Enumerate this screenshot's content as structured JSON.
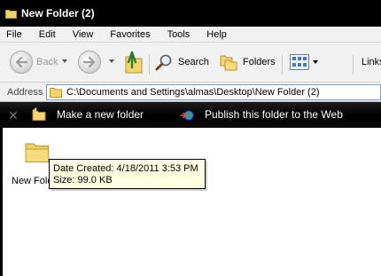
{
  "window": {
    "title": "New Folder (2)"
  },
  "menu": {
    "items": [
      "File",
      "Edit",
      "View",
      "Favorites",
      "Tools",
      "Help"
    ]
  },
  "toolbar": {
    "back_label": "Back",
    "search_label": "Search",
    "folders_label": "Folders",
    "links_label": "Links"
  },
  "address": {
    "label": "Address",
    "path": "C:\\Documents and Settings\\almas\\Desktop\\New Folder (2)"
  },
  "tasks": {
    "new_folder": "Make a new folder",
    "publish": "Publish this folder to the Web"
  },
  "content": {
    "item_label": "New Fold",
    "tooltip": {
      "created": "Date Created: 4/18/2011 3:53 PM",
      "size": "Size: 99.0 KB"
    }
  }
}
